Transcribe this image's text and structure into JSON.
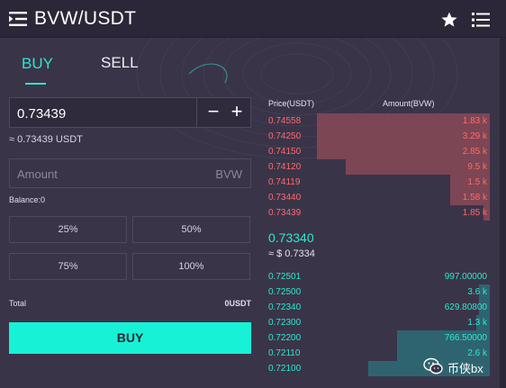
{
  "header": {
    "title": "BVW/USDT",
    "menu_icon": "menu-collapse-icon",
    "favorite_icon": "star-icon",
    "list_icon": "list-icon"
  },
  "tabs": [
    {
      "label": "BUY",
      "active": true
    },
    {
      "label": "SELL",
      "active": false
    }
  ],
  "form": {
    "price": "0.73439",
    "minus": "−",
    "plus": "+",
    "approx": "≈ 0.73439 USDT",
    "amount_placeholder": "Amount",
    "amount_unit": "BVW",
    "balance": "Balance:0",
    "percents": [
      "25%",
      "50%",
      "75%",
      "100%"
    ],
    "total_label": "Total",
    "total_value": "0USDT",
    "submit": "BUY"
  },
  "orderbook": {
    "price_header": "Price(USDT)",
    "amount_header": "Amount(BVW)",
    "asks": [
      {
        "price": "0.74558",
        "amount": "1.83 k",
        "depth": 0.78
      },
      {
        "price": "0.74250",
        "amount": "3.29 k",
        "depth": 0.78
      },
      {
        "price": "0.74150",
        "amount": "2.85 k",
        "depth": 0.78
      },
      {
        "price": "0.74120",
        "amount": "9.5 k",
        "depth": 0.65
      },
      {
        "price": "0.74119",
        "amount": "1.5 k",
        "depth": 0.18
      },
      {
        "price": "0.73440",
        "amount": "1.58 k",
        "depth": 0.18
      },
      {
        "price": "0.73439",
        "amount": "1.85 k",
        "depth": 0.03
      }
    ],
    "last_price": "0.73340",
    "last_fiat": "≈ $ 0.7334",
    "bids": [
      {
        "price": "0.72501",
        "amount": "997.00000",
        "depth": 0.0
      },
      {
        "price": "0.72500",
        "amount": "3.6 k",
        "depth": 0.05
      },
      {
        "price": "0.72340",
        "amount": "629.80800",
        "depth": 0.05
      },
      {
        "price": "0.72300",
        "amount": "1.3 k",
        "depth": 0.06
      },
      {
        "price": "0.72200",
        "amount": "766.50000",
        "depth": 0.42
      },
      {
        "price": "0.72110",
        "amount": "2.6 k",
        "depth": 0.42
      },
      {
        "price": "0.72100",
        "amount": "",
        "depth": 0.55
      }
    ]
  },
  "watermark": {
    "icon": "wechat-icon",
    "text": "币侠bx"
  },
  "colors": {
    "accent": "#17f2d6",
    "ask": "#ff6a6a",
    "bid": "#2ee8d0",
    "background": "#3a3449"
  }
}
